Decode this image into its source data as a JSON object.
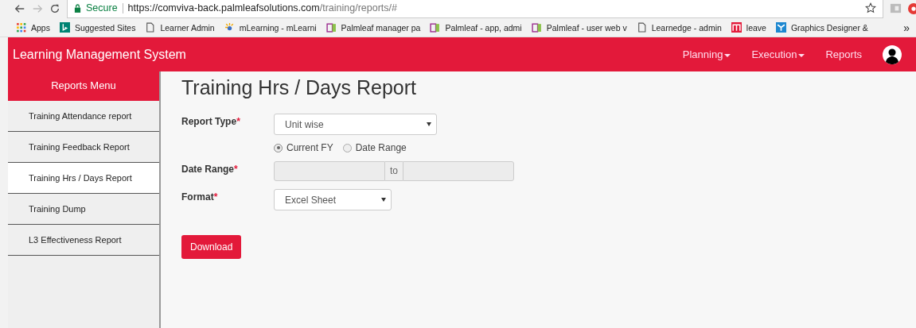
{
  "browser": {
    "secure_label": "Secure",
    "url_host": "https://comviva-back.palmleafsolutions.com",
    "url_path": "/training/reports/#",
    "bookmarks": [
      {
        "label": "Apps",
        "kind": "apps"
      },
      {
        "label": "Suggested Sites",
        "kind": "bing"
      },
      {
        "label": "Learner Admin",
        "kind": "page"
      },
      {
        "label": "mLearning - mLearni",
        "kind": "spark"
      },
      {
        "label": "Palmleaf manager pa",
        "kind": "book"
      },
      {
        "label": "Palmleaf - app, admi",
        "kind": "book"
      },
      {
        "label": "Palmleaf - user web v",
        "kind": "book"
      },
      {
        "label": "Learnedge - admin",
        "kind": "page"
      },
      {
        "label": "leave",
        "kind": "m"
      },
      {
        "label": "Graphics Designer &",
        "kind": "y"
      }
    ],
    "more": "»"
  },
  "navbar": {
    "brand": "Learning Management System",
    "items": [
      {
        "label": "Planning",
        "kind": "dropdown"
      },
      {
        "label": "Execution",
        "kind": "dropdown"
      },
      {
        "label": "Reports",
        "kind": "link"
      }
    ]
  },
  "sidebar": {
    "title": "Reports Menu",
    "items": [
      {
        "label": "Training Attendance report",
        "selected": false
      },
      {
        "label": "Training Feedback Report",
        "selected": false
      },
      {
        "label": "Training Hrs / Days Report",
        "selected": true
      },
      {
        "label": "Training Dump",
        "selected": false
      },
      {
        "label": "L3 Effectiveness Report",
        "selected": false
      }
    ]
  },
  "main": {
    "title": "Training Hrs / Days Report",
    "report_type": {
      "label": "Report Type",
      "required": "*",
      "value": "Unit wise"
    },
    "period_options": [
      {
        "label": "Current FY",
        "selected": true
      },
      {
        "label": "Date Range",
        "selected": false
      }
    ],
    "date_range": {
      "label": "Date Range",
      "required": "*",
      "separator": "to",
      "disabled": true
    },
    "format": {
      "label": "Format",
      "required": "*",
      "value": "Excel Sheet"
    },
    "download": "Download"
  }
}
